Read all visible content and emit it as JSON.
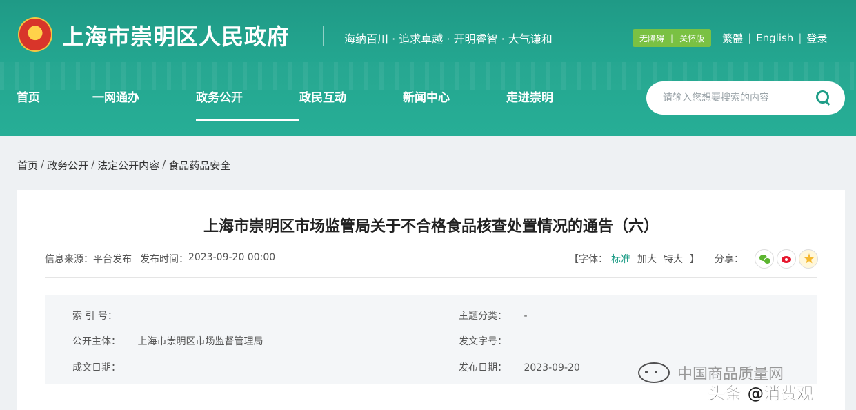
{
  "header": {
    "site_title": "上海市崇明区人民政府",
    "slogan": "海纳百川 · 追求卓越 · 开明睿智 · 大气谦和",
    "accessibility": "无障碍",
    "care_version": "关怀版",
    "traditional": "繁體",
    "english": "English",
    "login": "登录",
    "accent_color": "#23a58f"
  },
  "nav": {
    "items": [
      {
        "label": "首页"
      },
      {
        "label": "一网通办"
      },
      {
        "label": "政务公开"
      },
      {
        "label": "政民互动"
      },
      {
        "label": "新闻中心"
      },
      {
        "label": "走进崇明"
      }
    ],
    "active": "政务公开"
  },
  "search": {
    "placeholder": "请输入您想要搜索的内容",
    "icon": "search-icon"
  },
  "breadcrumb": {
    "items": [
      "首页",
      "政务公开",
      "法定公开内容",
      "食品药品安全"
    ],
    "separator": "/"
  },
  "article": {
    "title": "上海市崇明区市场监管局关于不合格食品核查处置情况的通告（六）",
    "source_label": "信息来源：",
    "source_value": "平台发布",
    "time_label": "发布时间：",
    "time_value": "2023-09-20 00:00",
    "font_open": "【字体：",
    "font_standard": "标准",
    "font_larger": "加大",
    "font_extra": "特大",
    "font_close": "】",
    "share_label": "分享："
  },
  "info": {
    "index_label": "索 引 号：",
    "index_value": "",
    "topic_label": "主题分类：",
    "topic_value": "-",
    "publisher_label": "公开主体：",
    "publisher_value": "上海市崇明区市场监督管理局",
    "doc_no_label": "发文字号：",
    "doc_no_value": "",
    "created_label": "成文日期：",
    "created_value": "",
    "published_label": "发布日期：",
    "published_value": "2023-09-20"
  },
  "watermark": {
    "line1": "中国商品质量网",
    "line2": "头条 @消费观"
  }
}
